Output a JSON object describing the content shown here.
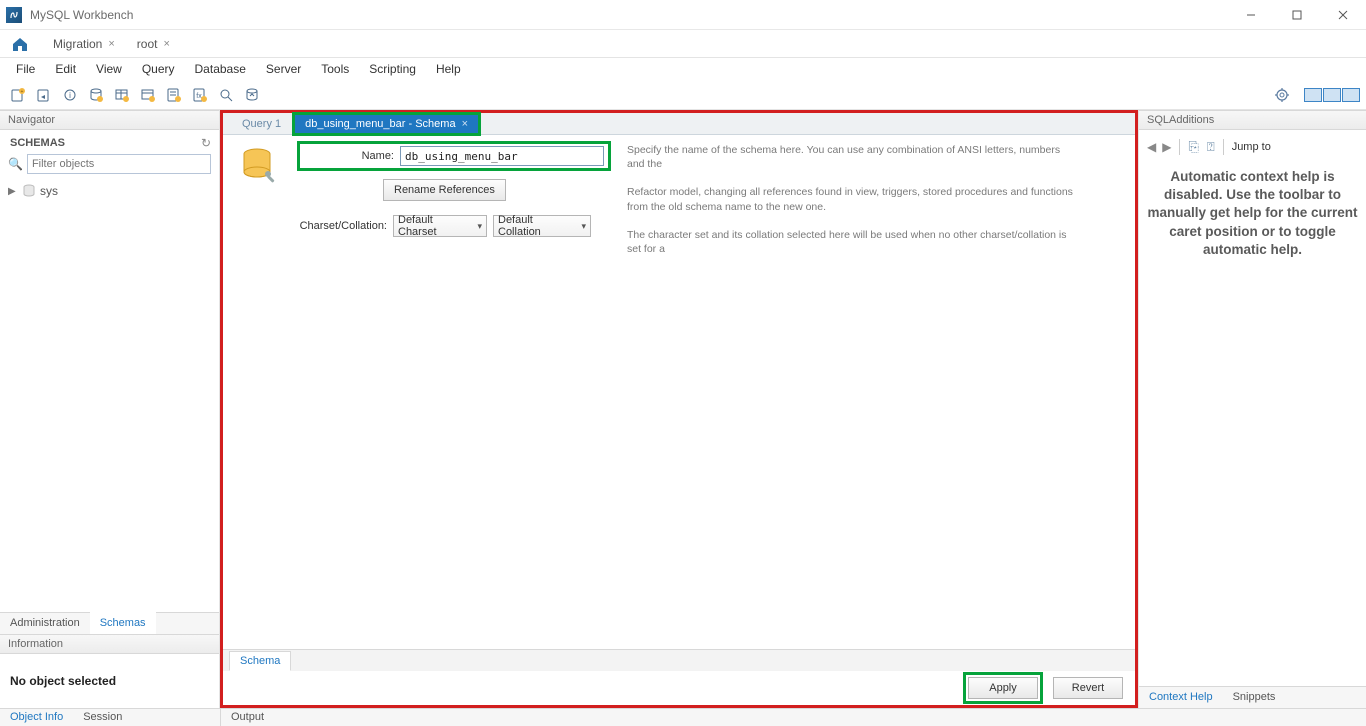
{
  "app": {
    "title": "MySQL Workbench"
  },
  "primary_tabs": {
    "items": [
      "Migration",
      "root"
    ]
  },
  "menu": {
    "items": [
      "File",
      "Edit",
      "View",
      "Query",
      "Database",
      "Server",
      "Tools",
      "Scripting",
      "Help"
    ]
  },
  "navigator": {
    "title": "Navigator",
    "schemas_label": "SCHEMAS",
    "filter_placeholder": "Filter objects",
    "tree": {
      "items": [
        "sys"
      ]
    },
    "bottom_tabs": [
      "Administration",
      "Schemas"
    ],
    "info_title": "Information",
    "info_body": "No object selected"
  },
  "center": {
    "tabs": [
      {
        "label": "Query 1",
        "active": false
      },
      {
        "label": "db_using_menu_bar - Schema",
        "active": true
      }
    ],
    "form": {
      "name_label": "Name:",
      "name_value": "db_using_menu_bar",
      "rename_btn": "Rename References",
      "charset_label": "Charset/Collation:",
      "charset_dd": "Default Charset",
      "collation_dd": "Default Collation"
    },
    "help": {
      "name": "Specify the name of the schema here. You can use any combination of ANSI letters, numbers and the",
      "rename": "Refactor model, changing all references found in view, triggers, stored procedures and functions from the old schema name to the new one.",
      "charset": "The character set and its collation selected here will be used when no other charset/collation is set for a"
    },
    "bottom_tab": "Schema",
    "apply": "Apply",
    "revert": "Revert"
  },
  "right": {
    "title": "SQLAdditions",
    "jump": "Jump to",
    "msg": "Automatic context help is disabled. Use the toolbar to manually get help for the current caret position or to toggle automatic help.",
    "tabs": [
      "Context Help",
      "Snippets"
    ]
  },
  "status": {
    "left_tabs": [
      "Object Info",
      "Session"
    ],
    "output": "Output"
  }
}
